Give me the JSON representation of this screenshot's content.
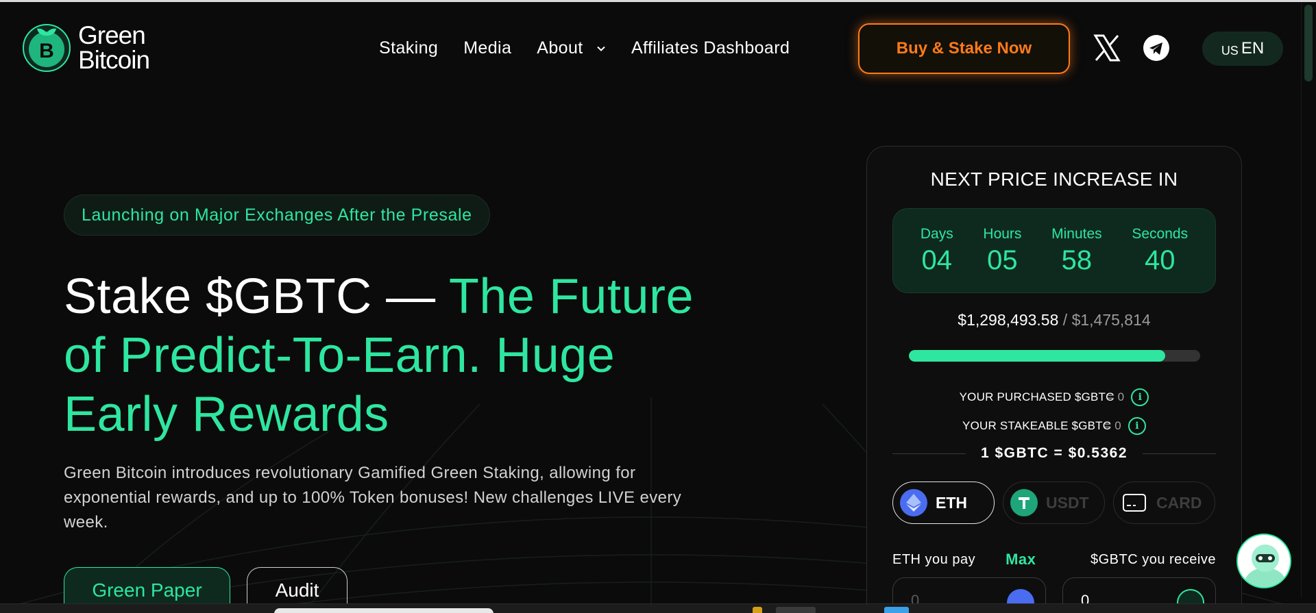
{
  "brand": {
    "line1": "Green",
    "line2": "Bitcoin"
  },
  "nav": {
    "items": [
      "Staking",
      "Media",
      "About",
      "Affiliates Dashboard"
    ]
  },
  "header": {
    "buy_label": "Buy & Stake Now",
    "lang_flag": "US",
    "lang_code": "EN"
  },
  "hero": {
    "pill": "Launching on Major Exchanges After the Presale",
    "title_white": "Stake $GBTC — ",
    "title_green": "The Future of Predict-To-Earn. Huge Early Rewards",
    "description": "Green Bitcoin introduces revolutionary Gamified Green Staking, allowing for exponential rewards, and up to 100% Token bonuses! New challenges LIVE every week.",
    "btn_primary": "Green Paper",
    "btn_secondary": "Audit"
  },
  "widget": {
    "title": "NEXT PRICE INCREASE IN",
    "countdown": [
      {
        "label": "Days",
        "value": "04"
      },
      {
        "label": "Hours",
        "value": "05"
      },
      {
        "label": "Minutes",
        "value": "58"
      },
      {
        "label": "Seconds",
        "value": "40"
      }
    ],
    "raised": "$1,298,493.58",
    "separator": " / ",
    "target": "$1,475,814",
    "progress_fraction": 0.88,
    "purchased_label": "YOUR PURCHASED $GBTC",
    "purchased_value": "= 0",
    "stakeable_label": "YOUR STAKEABLE $GBTC",
    "stakeable_value": "= 0",
    "rate": "1 $GBTC = $0.5362",
    "pay_tabs": [
      "ETH",
      "USDT",
      "CARD"
    ],
    "pay_label": "ETH you pay",
    "max_label": "Max",
    "receive_label": "$GBTC you receive",
    "pay_value": "0",
    "receive_value": "0"
  },
  "colors": {
    "accent": "#2ee6a0",
    "cta": "#ff7a1a",
    "background": "#0b0b0b"
  },
  "icons": [
    "green-bitcoin-logo",
    "chevron-down-icon",
    "x-icon",
    "telegram-icon",
    "info-icon",
    "eth-icon",
    "usdt-icon",
    "card-icon",
    "chat-bot-icon"
  ]
}
